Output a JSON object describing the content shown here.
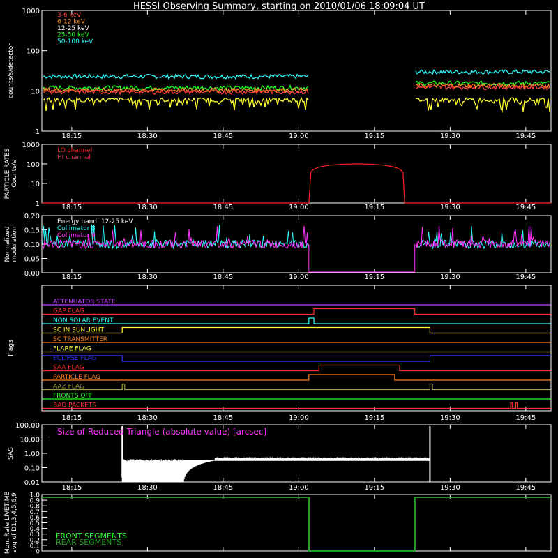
{
  "title": "HESSI Observing Summary, starting on 2010/01/06 18:09:04 UT",
  "time_ticks": [
    "18:15",
    "18:30",
    "18:45",
    "19:00",
    "19:15",
    "19:30",
    "19:45"
  ],
  "chart_data": [
    {
      "type": "line",
      "name": "count-rates",
      "ylabel": "counts/s/detector",
      "yscale": "log",
      "ylim": [
        1,
        1000
      ],
      "yticks": [
        "1",
        "10",
        "100",
        "1000"
      ],
      "series": [
        {
          "name": "3-6 keV",
          "color": "#ff4040",
          "level": 9.5
        },
        {
          "name": "6-12 keV",
          "color": "#ff9020",
          "level": 10.5
        },
        {
          "name": "12-25 keV",
          "color": "#ffffff",
          "level": 11
        },
        {
          "name": "25-50 keV",
          "color": "#20ff20",
          "level": 12
        },
        {
          "name": "50-100 keV",
          "color": "#30ffff",
          "level": 23
        }
      ],
      "gap": [
        "19:02",
        "19:23"
      ]
    },
    {
      "type": "line",
      "name": "particle-rates",
      "ylabel": "PARTICLE RATES Counts/s",
      "yscale": "log",
      "ylim": [
        1,
        1000
      ],
      "yticks": [
        "1",
        "10",
        "100",
        "1000"
      ],
      "series": [
        {
          "name": "LO channel",
          "color": "#ff2020"
        },
        {
          "name": "HI channel",
          "color": "#ff3060"
        }
      ],
      "peak": 100
    },
    {
      "type": "line",
      "name": "modulation",
      "ylabel": "Normalized modulation",
      "ylim": [
        0,
        0.2
      ],
      "yticks": [
        "0.00",
        "0.05",
        "0.10",
        "0.15",
        "0.20"
      ],
      "annotations": [
        "Energy band: 12-25 keV",
        "Collimator 8",
        "Collimator 9"
      ],
      "series": [
        {
          "name": "Collimator 8",
          "color": "#30ffff",
          "level": 0.1
        },
        {
          "name": "Collimator 9",
          "color": "#ff30ff",
          "level": 0.1
        }
      ]
    },
    {
      "type": "line",
      "name": "flags",
      "ylabel": "Flags",
      "series": [
        {
          "name": "ATTENUATOR STATE",
          "color": "#c040ff"
        },
        {
          "name": "GAP FLAG",
          "color": "#ff3030"
        },
        {
          "name": "NON SOLAR EVENT",
          "color": "#30ffff"
        },
        {
          "name": "SC IN SUNLIGHT",
          "color": "#ffff30"
        },
        {
          "name": "SC TRANSMITTER",
          "color": "#ff8020"
        },
        {
          "name": "FLARE FLAG",
          "color": "#ffff30"
        },
        {
          "name": "ECLIPSE FLAG",
          "color": "#3030ff"
        },
        {
          "name": "SAA FLAG",
          "color": "#ff3030"
        },
        {
          "name": "PARTICLE FLAG",
          "color": "#ff8020"
        },
        {
          "name": "AAZ FLAG",
          "color": "#a0a040"
        },
        {
          "name": "FRONTS OFF",
          "color": "#30ff30"
        },
        {
          "name": "BAD PACKETS",
          "color": "#ff3030"
        }
      ]
    },
    {
      "type": "line",
      "name": "sas",
      "ylabel": "SAS",
      "yscale": "log",
      "ylim": [
        0.01,
        100
      ],
      "yticks": [
        "0.01",
        "0.10",
        "1.00",
        "10.00",
        "100.00"
      ],
      "annotation": "Size of Reduced Triangle (absolute value) [arcsec]",
      "annotation_color": "#ff30ff",
      "series": [
        {
          "name": "Size of Reduced Triangle",
          "color": "#ffffff",
          "level": 0.4
        }
      ]
    },
    {
      "type": "line",
      "name": "livetime",
      "ylabel": "Mon. Rate LIVETIME avg of D1,3,4,5,6,9",
      "ylim": [
        0,
        1.0
      ],
      "yticks": [
        "0",
        "0.1",
        "0.2",
        "0.3",
        "0.4",
        "0.5",
        "0.6",
        "0.7",
        "0.8",
        "0.9",
        "1.0"
      ],
      "series": [
        {
          "name": "FRONT SEGMENTS",
          "color": "#30ff30",
          "level": 0.95
        },
        {
          "name": "REAR SEGMENTS",
          "color": "#20a020",
          "level": 0.95
        }
      ]
    }
  ]
}
